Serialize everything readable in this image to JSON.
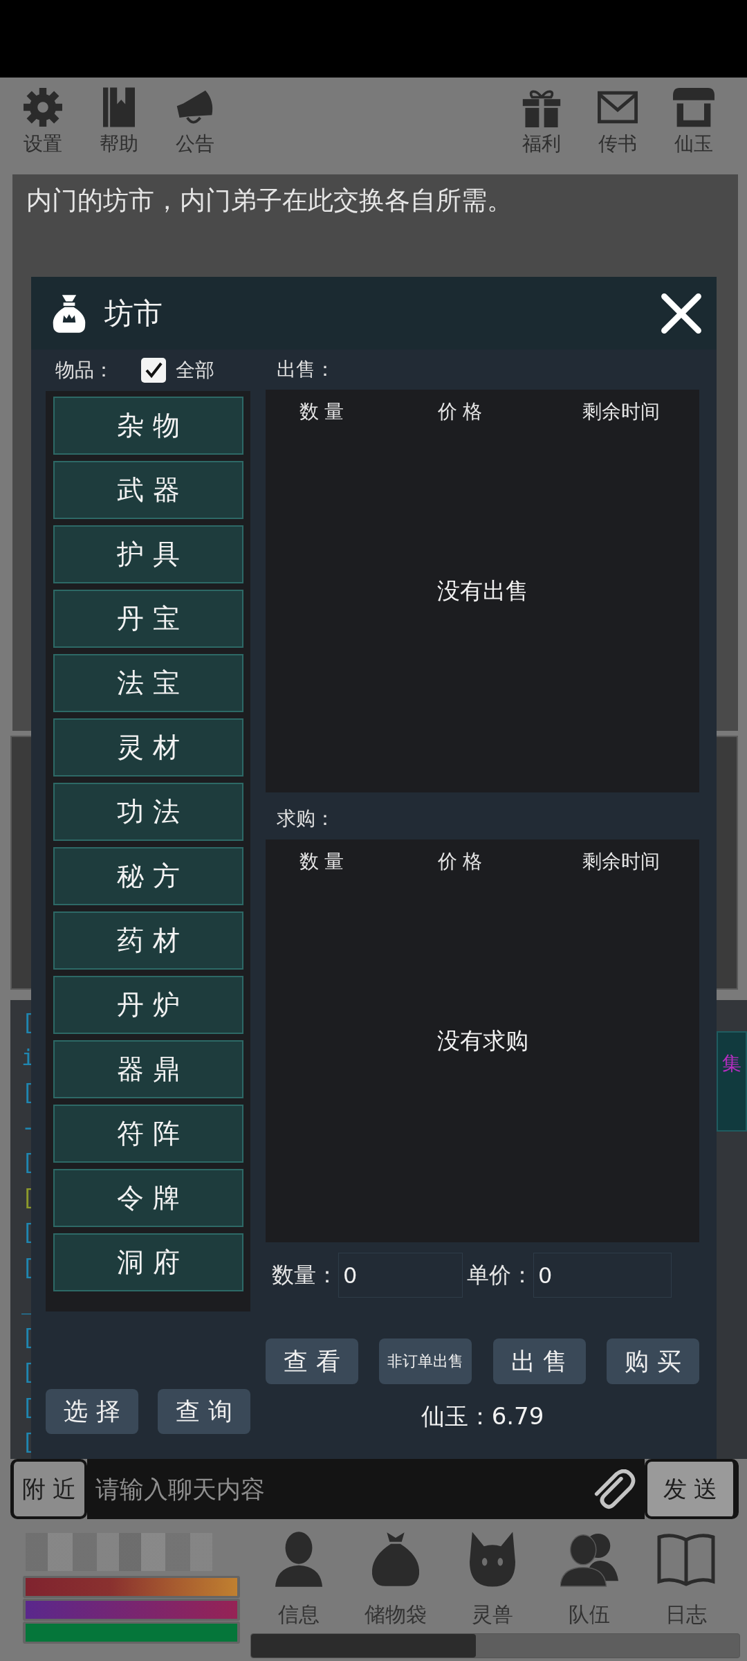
{
  "top_bar": {
    "left_buttons": [
      {
        "label": "设置"
      },
      {
        "label": "帮助"
      },
      {
        "label": "公告"
      }
    ],
    "right_buttons": [
      {
        "label": "福利"
      },
      {
        "label": "传书"
      },
      {
        "label": "仙玉"
      }
    ]
  },
  "description": "内门的坊市，内门弟子在此交换各自所需。",
  "chat_log": {
    "line_marks": [
      {
        "text": "[",
        "color": "#1f86b0"
      },
      {
        "text": "i",
        "color": "#1f86b0"
      },
      {
        "text": "[",
        "color": "#1f86b0"
      },
      {
        "text": "-",
        "color": "#1f86b0"
      },
      {
        "text": "[",
        "color": "#1f86b0"
      },
      {
        "text": "[",
        "color": "#8c9a2c"
      },
      {
        "text": "[",
        "color": "#1f86b0"
      },
      {
        "text": "[",
        "color": "#1f86b0"
      },
      {
        "text": "_",
        "color": "#1f86b0"
      },
      {
        "text": "[",
        "color": "#1f86b0"
      },
      {
        "text": "[",
        "color": "#1f86b0"
      },
      {
        "text": "[",
        "color": "#1f86b0"
      },
      {
        "text": "[",
        "color": "#1f86b0"
      }
    ],
    "side_tab": {
      "label": "集"
    }
  },
  "chat_bar": {
    "channel_button": "附 近",
    "input": {
      "placeholder": "请输入聊天内容"
    },
    "send_button": "发 送"
  },
  "player": {
    "bars": [
      {
        "level": 1,
        "color": "#80232f"
      },
      {
        "level": 1,
        "color": "#5a288c"
      },
      {
        "level": 1,
        "color": "#05763a"
      }
    ]
  },
  "bottom_nav": [
    {
      "label": "信息"
    },
    {
      "label": "储物袋"
    },
    {
      "label": "灵兽"
    },
    {
      "label": "队伍"
    },
    {
      "label": "日志"
    }
  ],
  "dialog": {
    "title": "坊市",
    "filter": {
      "label": "物品：",
      "all_checkbox": {
        "label": "全部",
        "checked": true
      }
    },
    "categories": [
      "杂 物",
      "武 器",
      "护 具",
      "丹 宝",
      "法 宝",
      "灵 材",
      "功 法",
      "秘 方",
      "药 材",
      "丹 炉",
      "器 鼎",
      "符 阵",
      "令 牌",
      "洞 府"
    ],
    "left_buttons": [
      "选 择",
      "查 询"
    ],
    "sell_section": {
      "label": "出售：",
      "columns": [
        "数 量",
        "价 格",
        "剩余时间"
      ],
      "empty_text": "没有出售"
    },
    "buy_section": {
      "label": "求购：",
      "columns": [
        "数 量",
        "价 格",
        "剩余时间"
      ],
      "empty_text": "没有求购"
    },
    "quantity": {
      "label": "数量：",
      "value": "0"
    },
    "unit_price": {
      "label": "单价：",
      "value": "0"
    },
    "action_buttons": [
      "查 看",
      "非订单出售",
      "出 售",
      "购 买"
    ],
    "balance": "仙玉：6.79"
  }
}
